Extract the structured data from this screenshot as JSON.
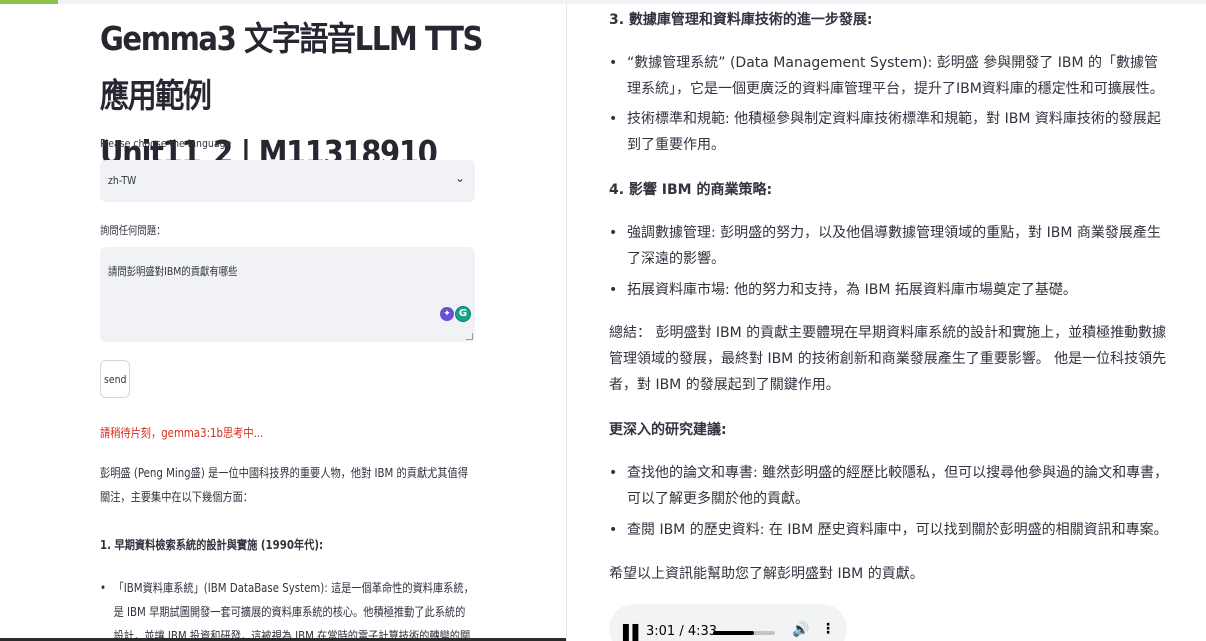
{
  "left": {
    "title_line1": "Gemma3 文字語音LLM TTS應用範例",
    "title_line2": "Unit11_2 | M11318910",
    "language_label": "Please choose the language",
    "language_value": "zh-TW",
    "question_label": "詢問任何問題：",
    "question_value": "請問彭明盛對IBM的貢獻有哪些",
    "send_label": "send",
    "status_text": "請稍待片刻，gemma3:1b思考中...",
    "response_intro": "彭明盛 (Peng Ming盛) 是一位中國科技界的重要人物，他對 IBM 的貢獻尤其值得關注，主要集中在以下幾個方面：",
    "section1_heading": "1. 早期資料檢索系統的設計與實施 (1990年代):",
    "section1_bullet": "「IBM資料庫系統」(IBM DataBase System): 這是一個革命性的資料庫系統，是 IBM 早期試圖開發一套可擴展的資料庫系統的核心。他積極推動了此系統的設計，並讓 IBM 投資和研發，這被視為 IBM 在當時的電子計算技術的轉變的關鍵步驟。"
  },
  "right": {
    "section3_heading": "3. 數據庫管理和資料庫技術的進一步發展:",
    "b1": "“數據管理系統” (Data Management System): 彭明盛 參與開發了 IBM 的「數據管理系統」，它是一個更廣泛的資料庫管理平台，提升了IBM資料庫的穩定性和可擴展性。",
    "b2": "技術標準和規範: 他積極參與制定資料庫技術標準和規範，對 IBM 資料庫技術的發展起到了重要作用。",
    "section4_heading": "4. 影響 IBM 的商業策略:",
    "b3": "強調數據管理: 彭明盛的努力，以及他倡導數據管理領域的重點，對 IBM 商業發展產生了深遠的影響。",
    "b4": "拓展資料庫市場: 他的努力和支持，為 IBM 拓展資料庫市場奠定了基礎。",
    "summary": "總結： 彭明盛對 IBM 的貢獻主要體現在早期資料庫系統的設計和實施上，並積極推動數據管理領域的發展，最終對 IBM 的技術創新和商業發展產生了重要影響。 他是一位科技領先者，對 IBM 的發展起到了關鍵作用。",
    "research_heading": "更深入的研究建議:",
    "b5": "查找他的論文和專書: 雖然彭明盛的經歷比較隱私，但可以搜尋他參與過的論文和專書，可以了解更多關於他的貢獻。",
    "b6": "查閱 IBM 的歷史資料: 在 IBM 歷史資料庫中，可以找到關於彭明盛的相關資訊和專案。",
    "closing": "希望以上資訊能幫助您了解彭明盛對 IBM 的貢獻。",
    "audio": {
      "time": "3:01 / 4:33",
      "progress": 0.663,
      "play_icon": "pause-icon",
      "volume_icon": "volume-icon",
      "more_icon": "more-vertical-icon"
    }
  },
  "colors": {
    "status_red": "#d12d1f",
    "input_bg": "#f0f2f6",
    "text": "#31333f"
  }
}
